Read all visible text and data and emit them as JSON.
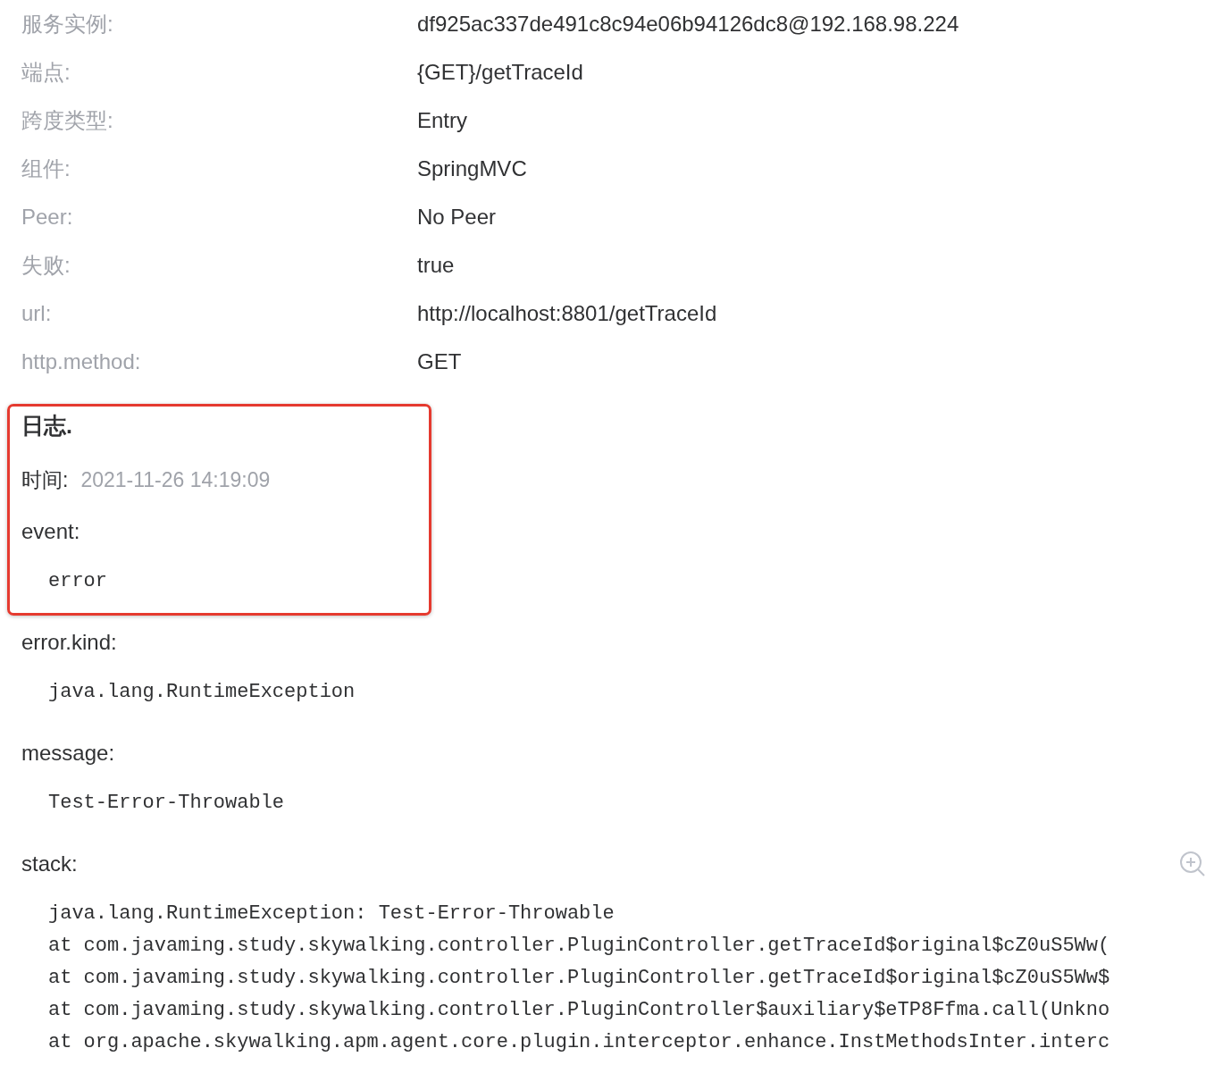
{
  "details": [
    {
      "label": "服务实例:",
      "value": "df925ac337de491c8c94e06b94126dc8@192.168.98.224"
    },
    {
      "label": "端点:",
      "value": "{GET}/getTraceId"
    },
    {
      "label": "跨度类型:",
      "value": "Entry"
    },
    {
      "label": "组件:",
      "value": "SpringMVC"
    },
    {
      "label": "Peer:",
      "value": "No Peer"
    },
    {
      "label": "失败:",
      "value": "true"
    },
    {
      "label": "url:",
      "value": "http://localhost:8801/getTraceId"
    },
    {
      "label": "http.method:",
      "value": "GET"
    }
  ],
  "log": {
    "title": "日志.",
    "time_label": "时间:",
    "time": "2021-11-26 14:19:09",
    "fields": [
      {
        "key": "event:",
        "highlighted": true,
        "zoomable": false,
        "lines": [
          "error"
        ]
      },
      {
        "key": "error.kind:",
        "highlighted": false,
        "zoomable": false,
        "lines": [
          "java.lang.RuntimeException"
        ]
      },
      {
        "key": "message:",
        "highlighted": false,
        "zoomable": false,
        "lines": [
          "Test-Error-Throwable"
        ]
      },
      {
        "key": "stack:",
        "highlighted": false,
        "zoomable": true,
        "lines": [
          "java.lang.RuntimeException: Test-Error-Throwable",
          "at com.javaming.study.skywalking.controller.PluginController.getTraceId$original$cZ0uS5Ww(",
          "at com.javaming.study.skywalking.controller.PluginController.getTraceId$original$cZ0uS5Ww$",
          "at com.javaming.study.skywalking.controller.PluginController$auxiliary$eTP8Ffma.call(Unkno",
          "at org.apache.skywalking.apm.agent.core.plugin.interceptor.enhance.InstMethodsInter.interc"
        ]
      }
    ]
  }
}
